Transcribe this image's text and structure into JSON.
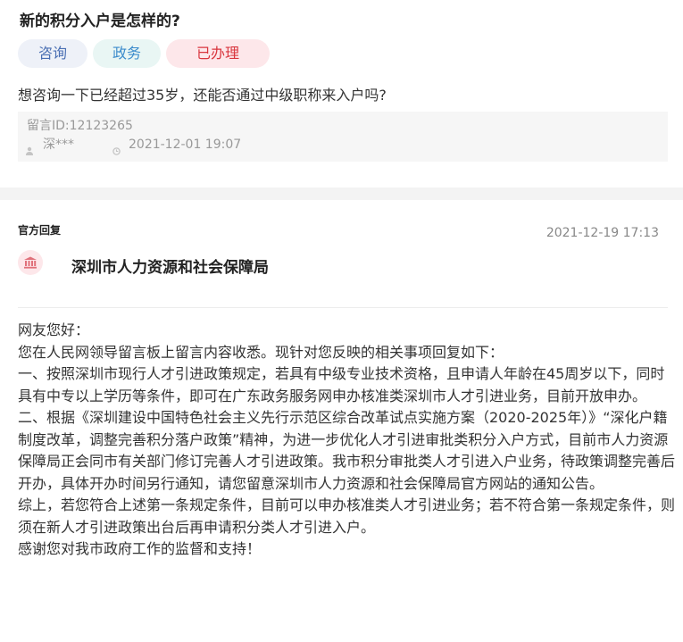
{
  "question": {
    "title": "新的积分入户是怎样的?",
    "tags": [
      "咨询",
      "政务",
      "已办理"
    ],
    "content": "想咨询一下已经超过35岁，还能否通过中级职称来入户吗?",
    "message_id": "留言ID:12123265",
    "author": "深***",
    "time": "2021-12-01 19:07"
  },
  "reply": {
    "label": "官方回复",
    "time": "2021-12-19 17:13",
    "org_name": "深圳市人力资源和社会保障局",
    "paragraphs": [
      "网友您好：",
      "您在人民网领导留言板上留言内容收悉。现针对您反映的相关事项回复如下：",
      "一、按照深圳市现行人才引进政策规定，若具有中级专业技术资格，且申请人年龄在45周岁以下，同时具有中专以上学历等条件，即可在广东政务服务网申办核准类深圳市人才引进业务，目前开放申办。",
      "二、根据《深圳建设中国特色社会主义先行示范区综合改革试点实施方案（2020-2025年）》“深化户籍制度改革，调整完善积分落户政策”精神，为进一步优化人才引进审批类积分入户方式，目前市人力资源保障局正会同市有关部门修订完善人才引进政策。我市积分审批类人才引进入户业务，待政策调整完善后开办，具体开办时间另行通知，请您留意深圳市人力资源和社会保障局官方网站的通知公告。",
      "综上，若您符合上述第一条规定条件，目前可以申办核准类人才引进业务；若不符合第一条规定条件，则须在新人才引进政策出台后再申请积分类人才引进入户。",
      "感谢您对我市政府工作的监督和支持！"
    ]
  },
  "colors": {
    "tag_consult_bg": "#eef1f8",
    "tag_gov_bg": "#e9f6f4",
    "tag_done_bg": "#fde7ea",
    "tag_done_text": "#d9363e"
  }
}
